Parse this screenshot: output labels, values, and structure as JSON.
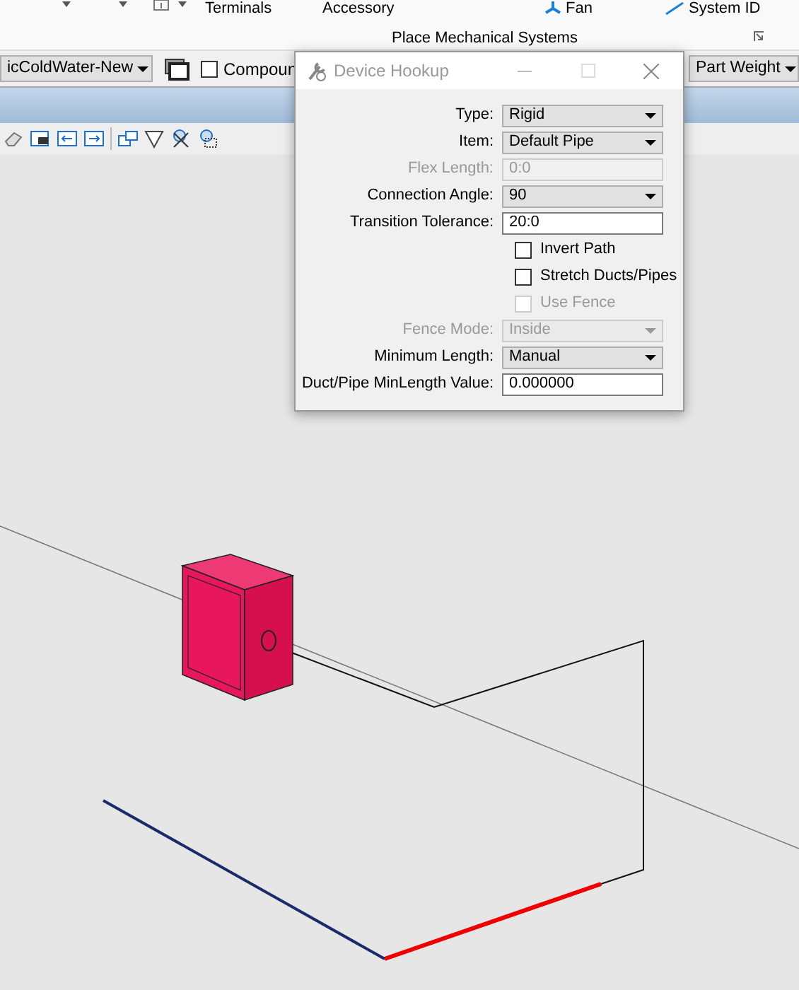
{
  "ribbon": {
    "items": [
      {
        "kind": "text",
        "label": "Terminals"
      },
      {
        "kind": "text",
        "label": "Accessory"
      },
      {
        "kind": "fan",
        "label": "Fan"
      },
      {
        "kind": "sysid",
        "label": "System ID"
      }
    ],
    "group_label": "Place Mechanical Systems"
  },
  "toolbar": {
    "system_combo": "icColdWater-New",
    "compound_label": "Compoun",
    "compound_checked": false,
    "weight_combo": "Part Weight"
  },
  "dialog": {
    "title": "Device Hookup",
    "fields": [
      {
        "kind": "select",
        "label": "Type:",
        "value": "Rigid",
        "disabled": false
      },
      {
        "kind": "select",
        "label": "Item:",
        "value": "Default Pipe",
        "disabled": false
      },
      {
        "kind": "text",
        "label": "Flex Length:",
        "value": "0:0",
        "disabled": true
      },
      {
        "kind": "select",
        "label": "Connection Angle:",
        "value": "90",
        "disabled": false
      },
      {
        "kind": "text",
        "label": "Transition Tolerance:",
        "value": "20:0",
        "disabled": false
      },
      {
        "kind": "checkbox",
        "label": "Invert Path",
        "checked": false,
        "disabled": false
      },
      {
        "kind": "checkbox",
        "label": "Stretch Ducts/Pipes",
        "checked": false,
        "disabled": false
      },
      {
        "kind": "checkbox",
        "label": "Use Fence",
        "checked": false,
        "disabled": true
      },
      {
        "kind": "select",
        "label": "Fence Mode:",
        "value": "Inside",
        "disabled": true
      },
      {
        "kind": "select",
        "label": "Minimum Length:",
        "value": "Manual",
        "disabled": false
      },
      {
        "kind": "text",
        "label": "Duct/Pipe MinLength Value:",
        "value": "0.000000",
        "disabled": false
      }
    ]
  }
}
